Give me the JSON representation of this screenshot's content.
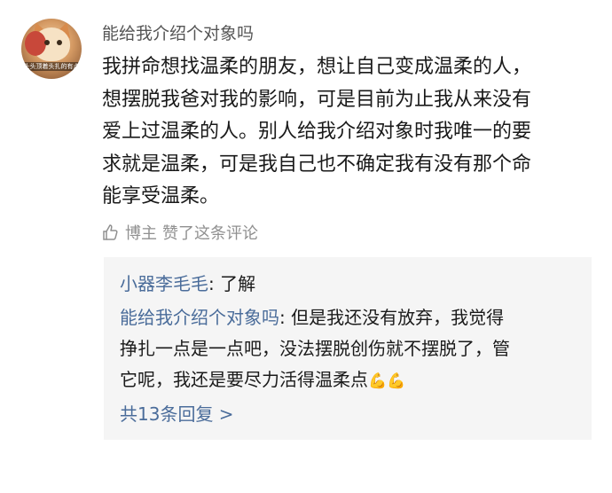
{
  "post": {
    "author": "能给我介绍个对象吗",
    "avatar_caption": "头头顶着头扎的有点",
    "text_lines": [
      "我拼命想找温柔的朋友，想让自己变成温柔的人，",
      "想摆脱我爸对我的影响，可是目前为止我从来没有",
      "爱上过温柔的人。别人给我介绍对象时我唯一的要",
      "求就是温柔，可是我自己也不确定我有没有那个命",
      "能享受温柔。"
    ],
    "like_icon": "thumbs-up-icon",
    "liked_by": "博主",
    "like_text": "赞了这条评论"
  },
  "replies": {
    "first": {
      "name": "小器李毛毛",
      "text": ": 了解"
    },
    "second": {
      "name": "能给我介绍个对象吗",
      "lines": [
        ": 但是我还没有放弃，我觉得",
        "挣扎一点是一点吧，没法摆脱创伤就不摆脱了，管",
        "它呢，我还是要尽力活得温柔点"
      ],
      "emoji": "💪💪"
    },
    "more_label": "共13条回复 >"
  },
  "colors": {
    "link": "#4a6c9a",
    "text": "#1a1a1a",
    "meta": "#909090",
    "reply_bg": "#f5f5f5"
  }
}
